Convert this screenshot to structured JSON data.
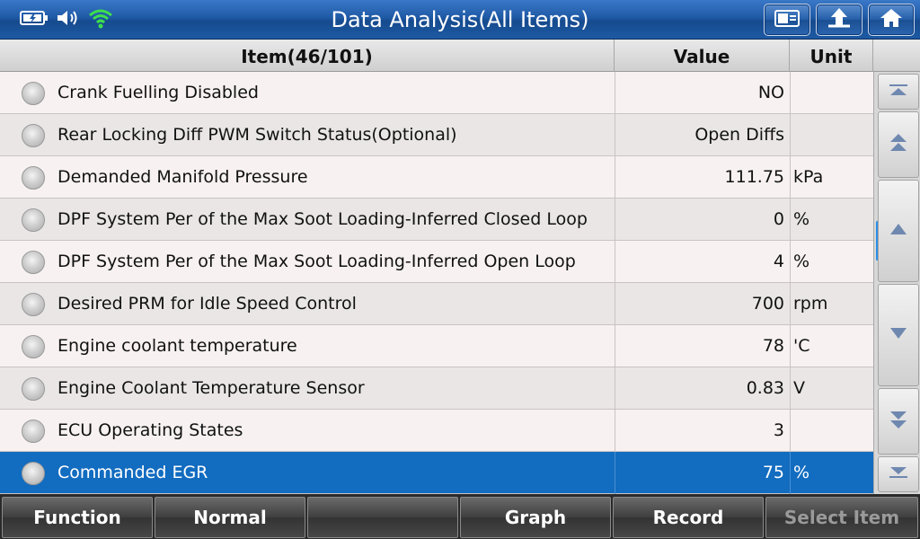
{
  "title": "Data Analysis(All Items)",
  "status_icons": [
    "battery-icon",
    "speaker-icon",
    "wifi-icon"
  ],
  "top_buttons": [
    "screenshot-icon",
    "back-icon",
    "home-icon"
  ],
  "table": {
    "header_item": "Item(46/101)",
    "header_value": "Value",
    "header_unit": "Unit",
    "rows": [
      {
        "name": "Crank Fuelling Disabled",
        "value": "NO",
        "unit": ""
      },
      {
        "name": "Rear Locking Diff PWM Switch Status(Optional)",
        "value": "Open Diffs",
        "unit": ""
      },
      {
        "name": "Demanded Manifold Pressure",
        "value": "111.75",
        "unit": "kPa"
      },
      {
        "name": "DPF System Per of the Max Soot Loading-Inferred Closed Loop",
        "value": "0",
        "unit": "%"
      },
      {
        "name": "DPF System Per of the Max Soot Loading-Inferred Open Loop",
        "value": "4",
        "unit": "%"
      },
      {
        "name": "Desired PRM for Idle Speed Control",
        "value": "700",
        "unit": "rpm"
      },
      {
        "name": "Engine coolant temperature",
        "value": "78",
        "unit": "'C"
      },
      {
        "name": "Engine Coolant Temperature Sensor",
        "value": "0.83",
        "unit": "V"
      },
      {
        "name": "ECU Operating States",
        "value": "3",
        "unit": ""
      },
      {
        "name": "Commanded EGR",
        "value": "75",
        "unit": "%"
      }
    ],
    "selected_row_index": 9
  },
  "colors": {
    "title_bar": "#1f5aa6",
    "selected_row": "#126cc0",
    "scroll_indicator": "#2b8fe6"
  },
  "bottom_buttons": {
    "function": "Function",
    "normal": "Normal",
    "blank": "",
    "graph": "Graph",
    "record": "Record",
    "select_item": "Select Item"
  }
}
